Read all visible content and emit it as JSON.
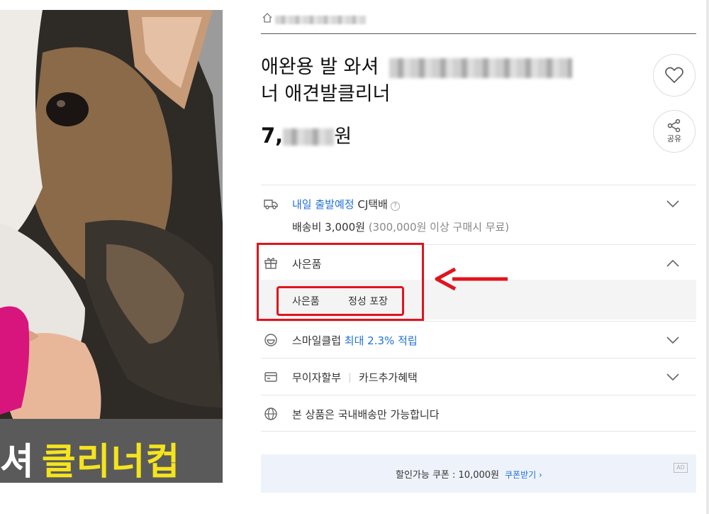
{
  "product": {
    "image_banner_prefix": "셔",
    "image_banner_text": "클리너컵",
    "title_line1": "애완용 발 와셔",
    "title_line2": "너 애견발클리너",
    "price_prefix": "7,",
    "price_suffix": "원"
  },
  "actions": {
    "share_label": "공유"
  },
  "delivery": {
    "schedule": "내일 출발예정",
    "carrier": "CJ택배",
    "help": "?",
    "fee": "배송비 3,000원",
    "fee_note": "(300,000원 이상 구매시 무료)"
  },
  "gift": {
    "title": "사은품",
    "items": [
      "사은품",
      "정성 포장"
    ]
  },
  "smileclub": {
    "label": "스마일클럽",
    "highlight": "최대 2.3% 적립"
  },
  "payment": {
    "label1": "무이자할부",
    "label2": "카드추가혜택"
  },
  "shipping_region": {
    "label": "본 상품은 국내배송만 가능합니다"
  },
  "coupon": {
    "label": "할인가능 쿠폰 : 10,000원",
    "link": "쿠폰받기 ›",
    "ad": "AD"
  },
  "colors": {
    "accent_blue": "#1f6fd9",
    "annotation_red": "#e0141e",
    "banner_yellow": "#f5e41d"
  }
}
